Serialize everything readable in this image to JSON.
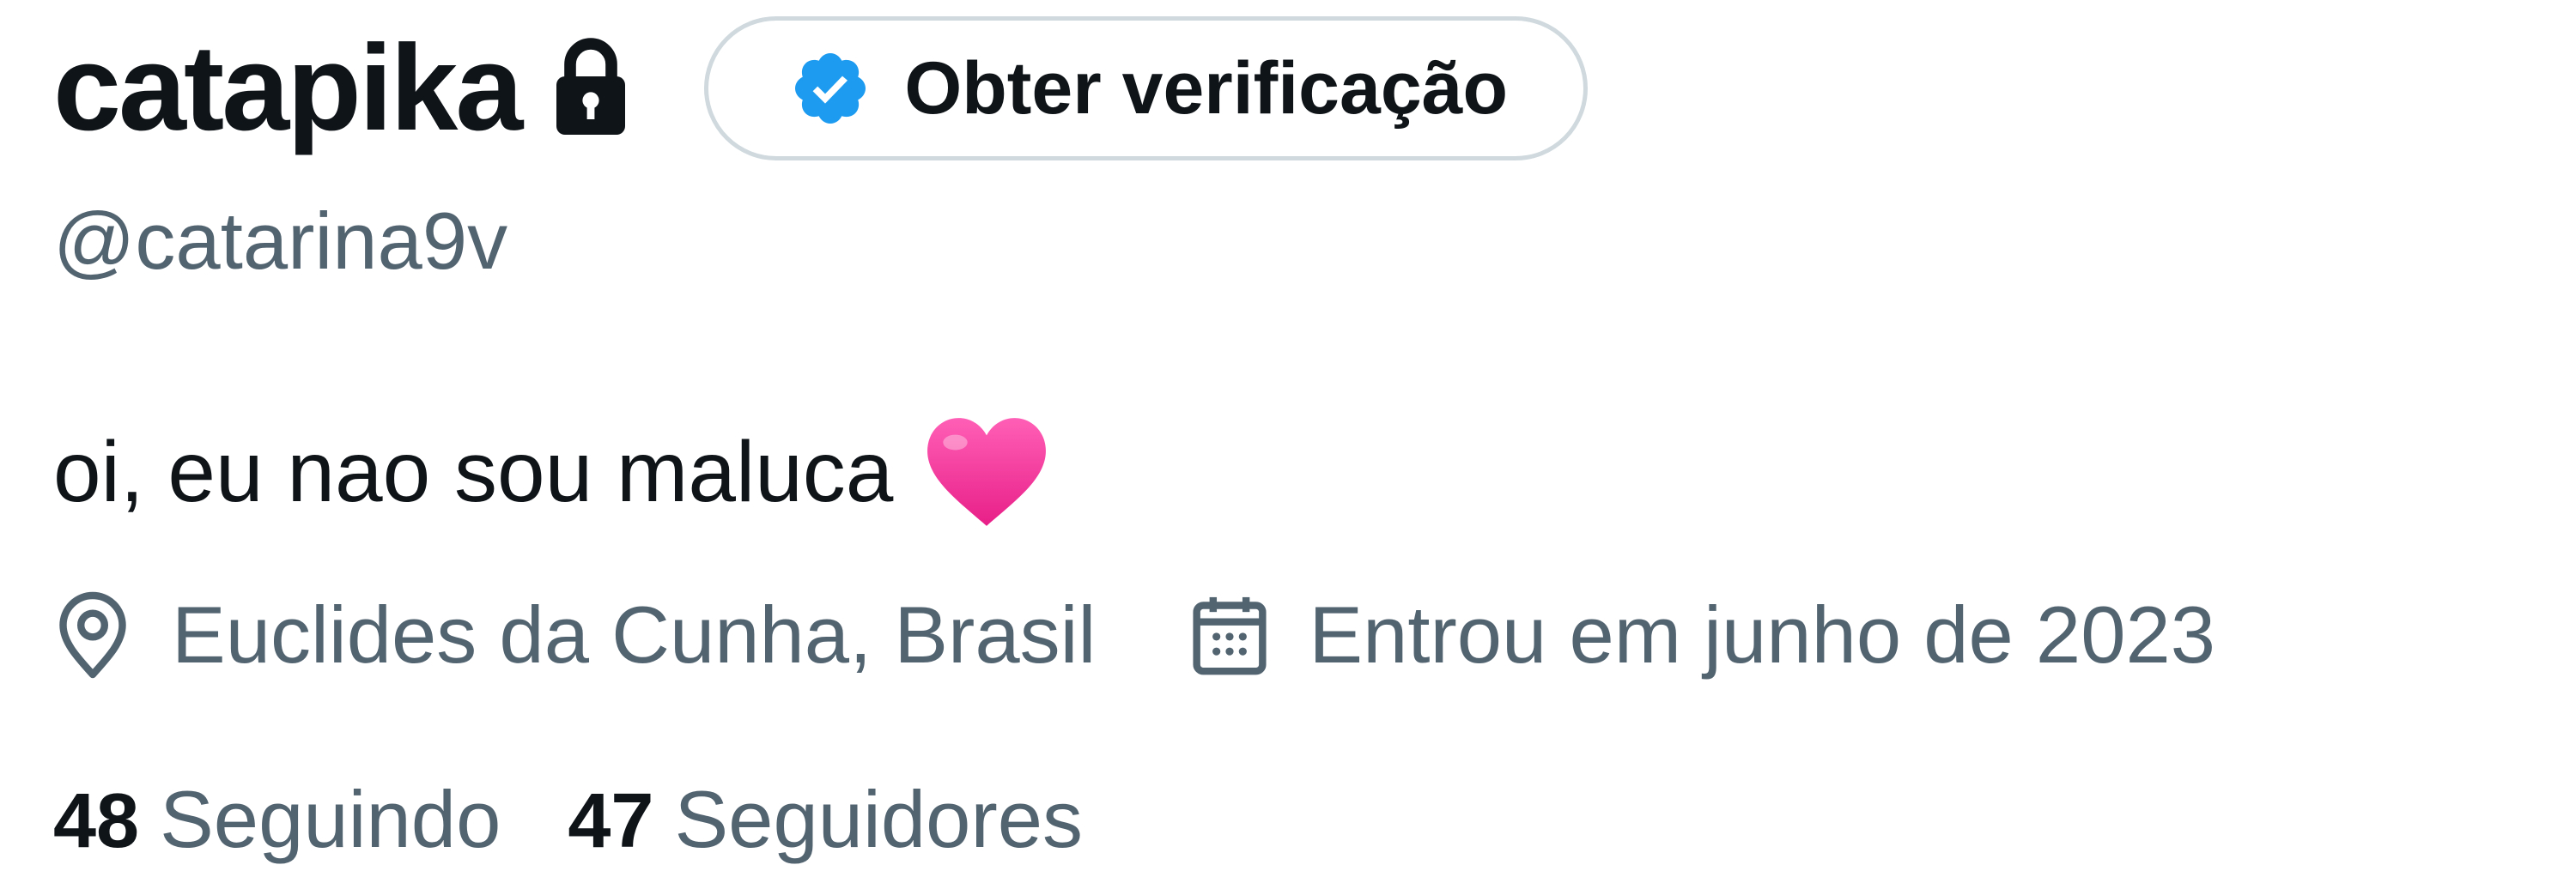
{
  "profile": {
    "display_name": "catapika",
    "handle": "@catarina9v",
    "bio": "oi, eu nao sou maluca",
    "location": "Euclides da Cunha, Brasil",
    "joined": "Entrou em junho de 2023"
  },
  "verify_button": {
    "label": "Obter verificação"
  },
  "stats": {
    "following_count": "48",
    "following_label": "Seguindo",
    "followers_count": "47",
    "followers_label": "Seguidores"
  },
  "icons": {
    "lock": "lock-icon",
    "verified_badge": "verified-badge-icon",
    "heart": "pink-heart-emoji",
    "location": "location-pin-icon",
    "calendar": "calendar-icon"
  },
  "colors": {
    "text_primary": "#0f1419",
    "text_secondary": "#536471",
    "verified_blue": "#1d9bf0",
    "button_border": "#cfd9de",
    "heart_pink": "#f0449a"
  }
}
